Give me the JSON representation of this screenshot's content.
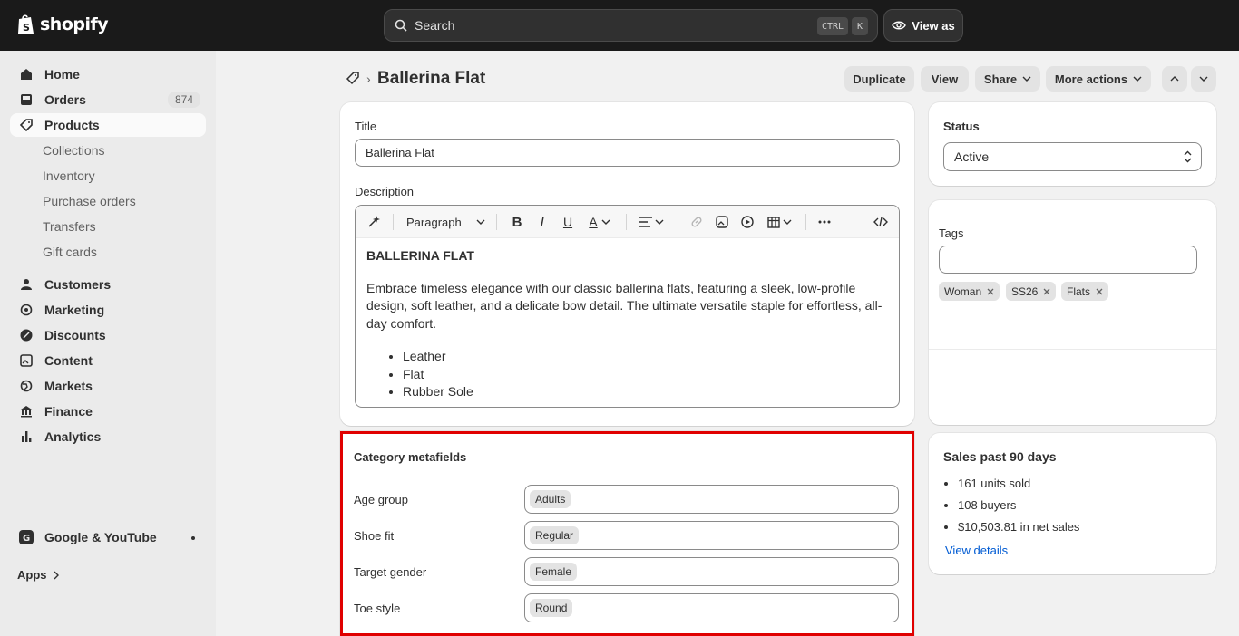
{
  "topbar": {
    "brand": "shopify",
    "search_placeholder": "Search",
    "shortcut_ctrl": "CTRL",
    "shortcut_k": "K",
    "view_as": "View as"
  },
  "sidebar": {
    "items": [
      {
        "label": "Home"
      },
      {
        "label": "Orders",
        "badge": "874"
      },
      {
        "label": "Products"
      },
      {
        "label": "Customers"
      },
      {
        "label": "Marketing"
      },
      {
        "label": "Discounts"
      },
      {
        "label": "Content"
      },
      {
        "label": "Markets"
      },
      {
        "label": "Finance"
      },
      {
        "label": "Analytics"
      }
    ],
    "product_sub": [
      "Collections",
      "Inventory",
      "Purchase orders",
      "Transfers",
      "Gift cards"
    ],
    "sales_channel": "Google & YouTube",
    "apps": "Apps"
  },
  "header": {
    "title": "Ballerina Flat",
    "buttons": {
      "duplicate": "Duplicate",
      "view": "View",
      "share": "Share",
      "more": "More actions"
    }
  },
  "product": {
    "title_label": "Title",
    "title_value": "Ballerina Flat",
    "description_label": "Description",
    "paragraph_select": "Paragraph",
    "description": {
      "heading": "BALLERINA FLAT",
      "body": "Embrace timeless elegance with our classic ballerina flats, featuring a sleek, low-profile design, soft leather, and a delicate bow detail. The ultimate versatile staple for effortless, all-day comfort.",
      "bullets": [
        "Leather",
        "Flat",
        "Rubber Sole"
      ]
    }
  },
  "metafields": {
    "title": "Category metafields",
    "rows": [
      {
        "label": "Age group",
        "value": "Adults"
      },
      {
        "label": "Shoe fit",
        "value": "Regular"
      },
      {
        "label": "Target gender",
        "value": "Female"
      },
      {
        "label": "Toe style",
        "value": "Round"
      }
    ]
  },
  "status": {
    "label": "Status",
    "value": "Active"
  },
  "tags": {
    "label": "Tags",
    "items": [
      "Woman",
      "SS26",
      "Flats"
    ]
  },
  "sales": {
    "title": "Sales past 90 days",
    "stats": [
      "161 units sold",
      "108 buyers",
      "$10,503.81 in net sales"
    ],
    "link": "View details"
  },
  "colors": {
    "topbar": "#1a1a1a",
    "highlight": "#e00000",
    "link": "#005bd3"
  }
}
